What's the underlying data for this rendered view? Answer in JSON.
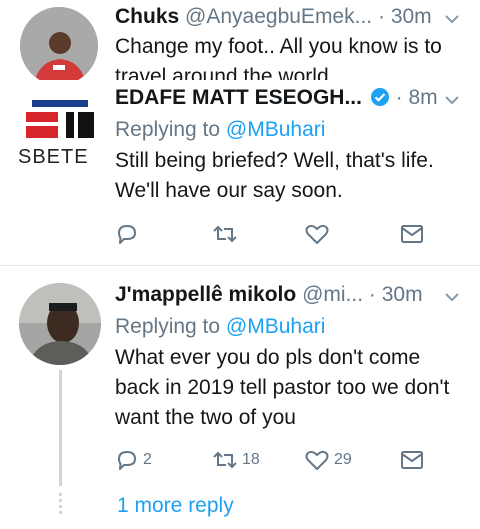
{
  "tweets": [
    {
      "name": "Chuks",
      "handle": "@AnyaegbuEmek...",
      "time": "30m",
      "text": "Change my foot.. All you know is to travel around the world"
    },
    {
      "name": "EDAFE MATT ESEOGH...",
      "verified": true,
      "time": "8m",
      "replying_label": "Replying to",
      "replying_to": "@MBuhari",
      "text": "Still being briefed? Well, that's life. We'll have our say soon.",
      "avatar_text": "SBETE"
    },
    {
      "name": "J'mappellê mikolo",
      "handle": "@mi...",
      "time": "30m",
      "replying_label": "Replying to",
      "replying_to": "@MBuhari",
      "text": "What ever you do pls don't come back in 2019 tell pastor too we don't want the two of you",
      "reply_count": "2",
      "retweet_count": "18",
      "like_count": "29"
    }
  ],
  "more_replies_label": "1 more reply",
  "dot": "·",
  "colors": {
    "accent": "#1da1f2",
    "muted": "#657786",
    "text": "#14171a",
    "divider": "#e1e8ed",
    "logo_red": "#d7262b",
    "logo_blue": "#1b3d8f"
  }
}
